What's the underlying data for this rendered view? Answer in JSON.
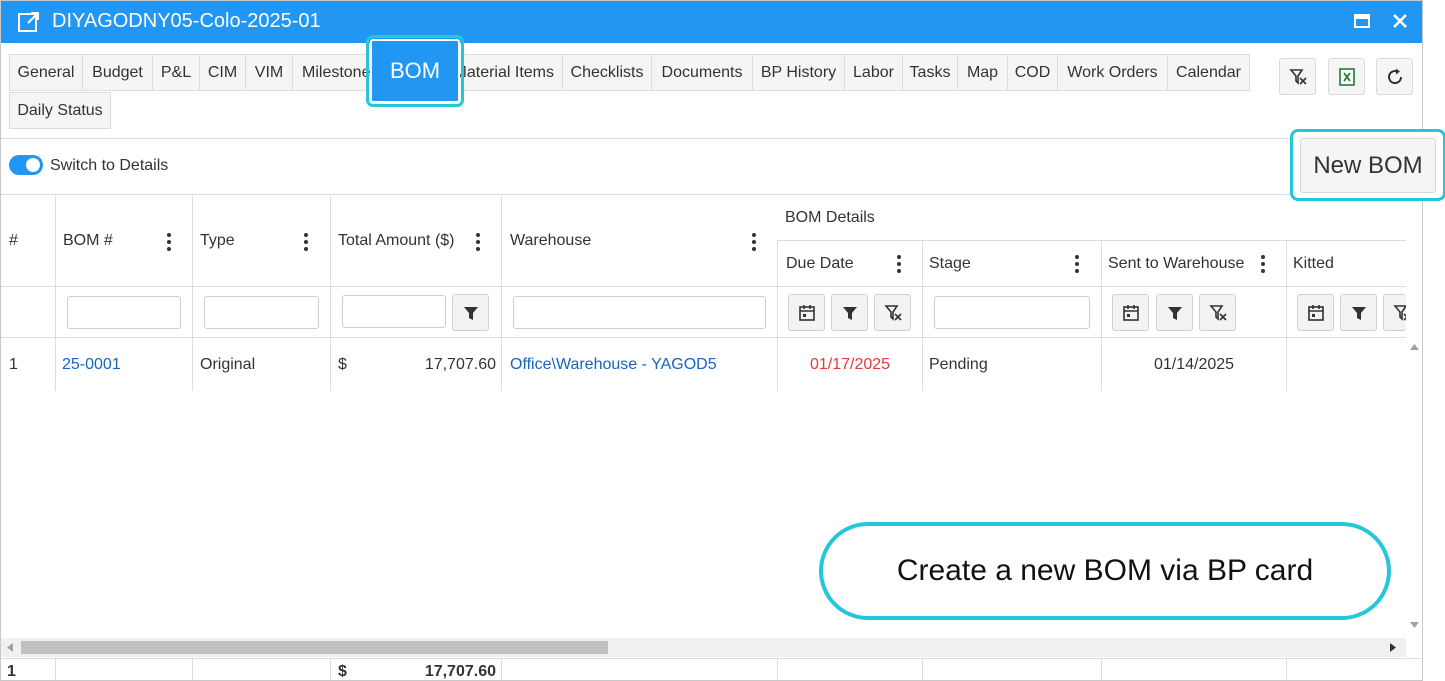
{
  "window": {
    "title": "DIYAGODNY05-Colo-2025-01"
  },
  "tabs": [
    {
      "label": "General"
    },
    {
      "label": "Budget"
    },
    {
      "label": "P&L"
    },
    {
      "label": "CIM"
    },
    {
      "label": "VIM"
    },
    {
      "label": "Milestones"
    },
    {
      "label": "BOM"
    },
    {
      "label": "Material Items"
    },
    {
      "label": "Checklists"
    },
    {
      "label": "Documents"
    },
    {
      "label": "BP History"
    },
    {
      "label": "Labor"
    },
    {
      "label": "Tasks"
    },
    {
      "label": "Map"
    },
    {
      "label": "COD"
    },
    {
      "label": "Work Orders"
    },
    {
      "label": "Calendar"
    },
    {
      "label": "Daily Status"
    }
  ],
  "active_tab": "BOM",
  "toolbar": {
    "icons": [
      "clear-filter-icon",
      "excel-export-icon",
      "refresh-icon"
    ]
  },
  "toggle": {
    "label": "Switch to Details",
    "on": true
  },
  "new_bom_label": "New BOM",
  "grid": {
    "columns": {
      "num": "#",
      "bom": "BOM #",
      "type": "Type",
      "total": "Total Amount ($)",
      "warehouse": "Warehouse",
      "group": "BOM Details",
      "due": "Due Date",
      "stage": "Stage",
      "sent": "Sent to Warehouse",
      "kitted": "Kitted"
    },
    "rows": [
      {
        "num": "1",
        "bom": "25-0001",
        "type": "Original",
        "currency": "$",
        "total": "17,707.60",
        "warehouse": "Office\\Warehouse - YAGOD5",
        "due": "01/17/2025",
        "stage": "Pending",
        "sent": "01/14/2025",
        "kitted": ""
      }
    ],
    "footer": {
      "count": "1",
      "currency": "$",
      "total": "17,707.60"
    }
  },
  "colors": {
    "primary": "#2196f3",
    "highlight": "#26c6da",
    "due_date": "#e53935",
    "link": "#1565c0"
  },
  "callout": {
    "text": "Create a new BOM via BP card"
  }
}
